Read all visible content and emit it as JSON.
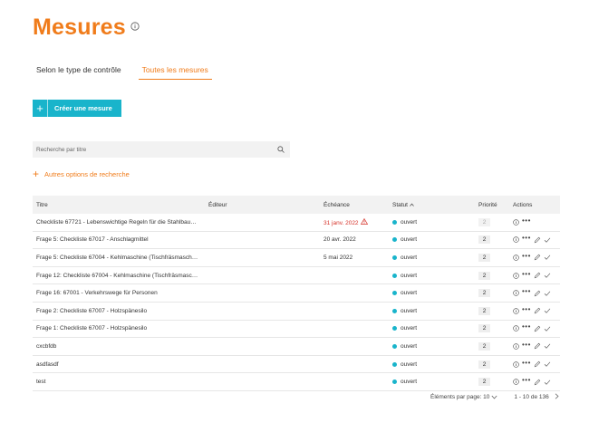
{
  "header": {
    "title": "Mesures"
  },
  "tabs": [
    {
      "label": "Selon le type de contrôle",
      "active": false
    },
    {
      "label": "Toutes les mesures",
      "active": true
    }
  ],
  "create_button": {
    "label": "Créer une mesure"
  },
  "search": {
    "placeholder": "Recherche par titre"
  },
  "more_options": {
    "label": "Autres options de recherche"
  },
  "table": {
    "columns": {
      "title": "Titre",
      "editor": "Éditeur",
      "due": "Échéance",
      "status": "Statut",
      "priority": "Priorité",
      "actions": "Actions"
    },
    "rows": [
      {
        "title": "Checkliste 67721 - Lebenswichtige Regeln für die Stahlbau…",
        "editor": "",
        "due": "31 janv. 2022",
        "status": "ouvert",
        "priority": "2"
      },
      {
        "title": "Frage 5: Checkliste 67017 - Anschlagmittel",
        "editor": "",
        "due": "20 avr. 2022",
        "status": "ouvert",
        "priority": "2"
      },
      {
        "title": "Frage 5: Checkliste 67004 - Kehlmaschine (Tischfräsmasch…",
        "editor": "",
        "due": "5 mai 2022",
        "status": "ouvert",
        "priority": "2"
      },
      {
        "title": "Frage 12: Checkliste 67004 - Kehlmaschine (Tischfräsmasc…",
        "editor": "",
        "due": "",
        "status": "ouvert",
        "priority": "2"
      },
      {
        "title": "Frage 16: 67001 - Verkehrswege für Personen",
        "editor": "",
        "due": "",
        "status": "ouvert",
        "priority": "2"
      },
      {
        "title": "Frage 2: Checkliste 67007 - Holzspänesilo",
        "editor": "",
        "due": "",
        "status": "ouvert",
        "priority": "2"
      },
      {
        "title": "Frage 1: Checkliste 67007 - Holzspänesilo",
        "editor": "",
        "due": "",
        "status": "ouvert",
        "priority": "2"
      },
      {
        "title": "cxcbfdb",
        "editor": "",
        "due": "",
        "status": "ouvert",
        "priority": "2"
      },
      {
        "title": "asdfasdf",
        "editor": "",
        "due": "",
        "status": "ouvert",
        "priority": "2"
      },
      {
        "title": "test",
        "editor": "",
        "due": "",
        "status": "ouvert",
        "priority": "2"
      }
    ]
  },
  "pagination": {
    "per_page_label": "Éléments par page: 10",
    "range": "1 - 10 de 136"
  },
  "colors": {
    "accent": "#f07c1b",
    "primary": "#19b4cb",
    "danger": "#d6342b"
  }
}
